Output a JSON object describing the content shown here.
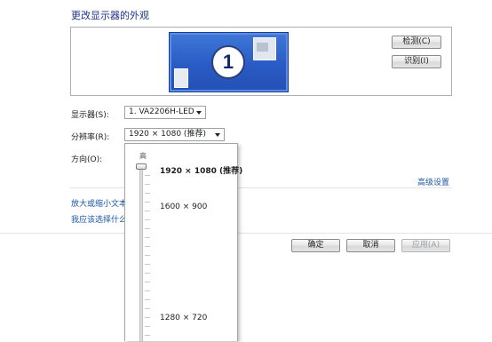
{
  "header": {
    "title": "更改显示器的外观"
  },
  "preview": {
    "monitor_number": "1",
    "detect_button": "检测(C)",
    "identify_button": "识别(I)"
  },
  "fields": {
    "display_label": "显示器(S):",
    "display_value": "1. VA2206H-LED",
    "resolution_label": "分辨率(R):",
    "resolution_value": "1920 × 1080 (推荐)",
    "orientation_label": "方向(O):"
  },
  "links": {
    "advanced_settings": "高级设置",
    "enlarge_text": "放大或缩小文本",
    "help": "我应该选择什么"
  },
  "footer": {
    "ok": "确定",
    "cancel": "取消",
    "apply": "应用(A)"
  },
  "resolution_dropdown": {
    "high_label": "高",
    "options": [
      "1920 × 1080 (推荐)",
      "1600 × 900",
      "1280 × 720"
    ],
    "selected_index": 0
  },
  "colors": {
    "title": "#1e3287",
    "link": "#1e57a8",
    "monitor_blue": "#2a5bc5"
  }
}
